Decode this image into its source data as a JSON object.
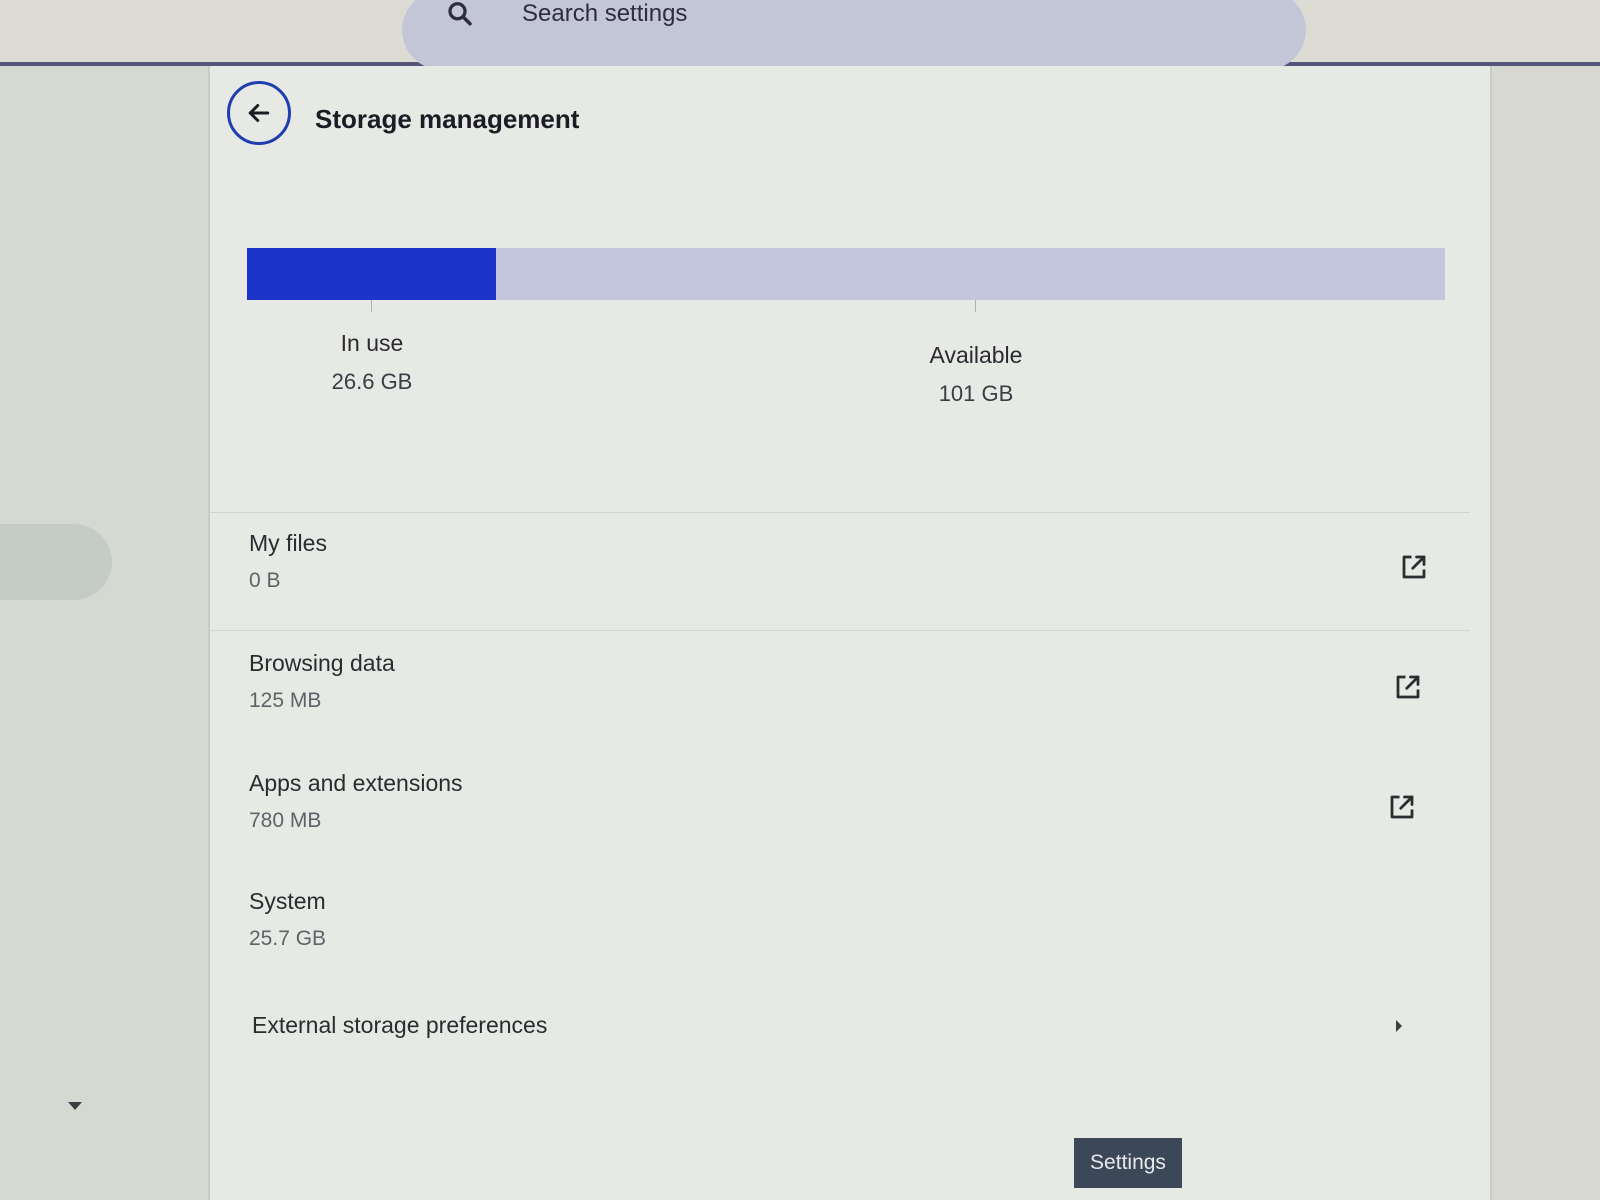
{
  "search": {
    "placeholder": "Search settings"
  },
  "header": {
    "title": "Storage management"
  },
  "storage": {
    "used_fraction": 0.208,
    "in_use_label": "In use",
    "in_use_value": "26.6 GB",
    "available_label": "Available",
    "available_value": "101 GB",
    "colors": {
      "used": "#1a35c8",
      "available": "#c3c6dc"
    }
  },
  "rows": [
    {
      "name": "My files",
      "size": "0 B",
      "icon": "open-in-new-icon"
    },
    {
      "name": "Browsing data",
      "size": "125 MB",
      "icon": "open-in-new-icon"
    },
    {
      "name": "Apps and extensions",
      "size": "780 MB",
      "icon": "open-in-new-icon"
    },
    {
      "name": "System",
      "size": "25.7 GB",
      "icon": ""
    }
  ],
  "external": {
    "label": "External storage preferences",
    "icon": "chevron-right-icon"
  },
  "tooltip": {
    "label": "Settings"
  }
}
